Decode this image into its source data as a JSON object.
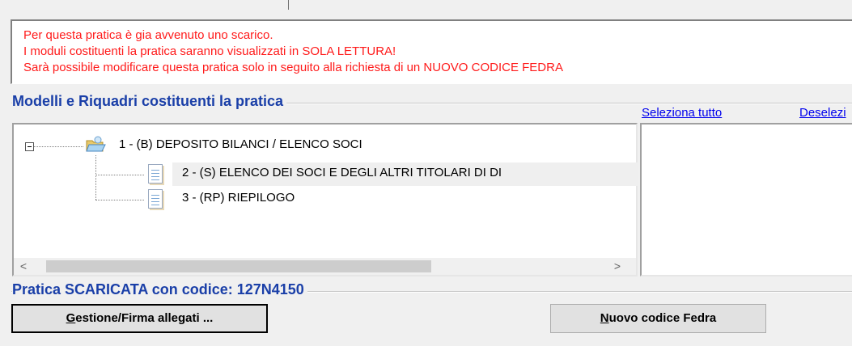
{
  "message": {
    "line1": "Per questa pratica è gia avvenuto uno scarico.",
    "line2": "I moduli costituenti la pratica saranno visualizzati in SOLA LETTURA!",
    "line3": "Sarà possibile modificare questa pratica solo in seguito alla richiesta di un NUOVO CODICE FEDRA",
    "color": "#ff1a1a"
  },
  "models_section": {
    "title": "Modelli e Riquadri costituenti la pratica",
    "select_all": "Seleziona tutto",
    "deselect_all": "Deselezi"
  },
  "tree": {
    "items": [
      {
        "label": "1 - (B) DEPOSITO BILANCI / ELENCO SOCI",
        "icon": "open-folder-icon",
        "level": 0
      },
      {
        "label": "2 - (S) ELENCO DEI SOCI E DEGLI ALTRI TITOLARI DI DI",
        "icon": "document-icon",
        "level": 1,
        "selected": true
      },
      {
        "label": "3 - (RP) RIEPILOGO",
        "icon": "document-icon",
        "level": 1
      }
    ]
  },
  "scrollbar": {
    "left_arrow": "<",
    "right_arrow": ">"
  },
  "status_section": {
    "title": "Pratica SCARICATA con codice: 127N4150"
  },
  "buttons": {
    "allegati_accel": "G",
    "allegati_rest": "estione/Firma allegati ...",
    "fedra_accel": "N",
    "fedra_rest": "uovo codice Fedra"
  },
  "colors": {
    "section_title": "#1a3fa8",
    "link": "#0000ee",
    "background": "#f0f0f0"
  }
}
